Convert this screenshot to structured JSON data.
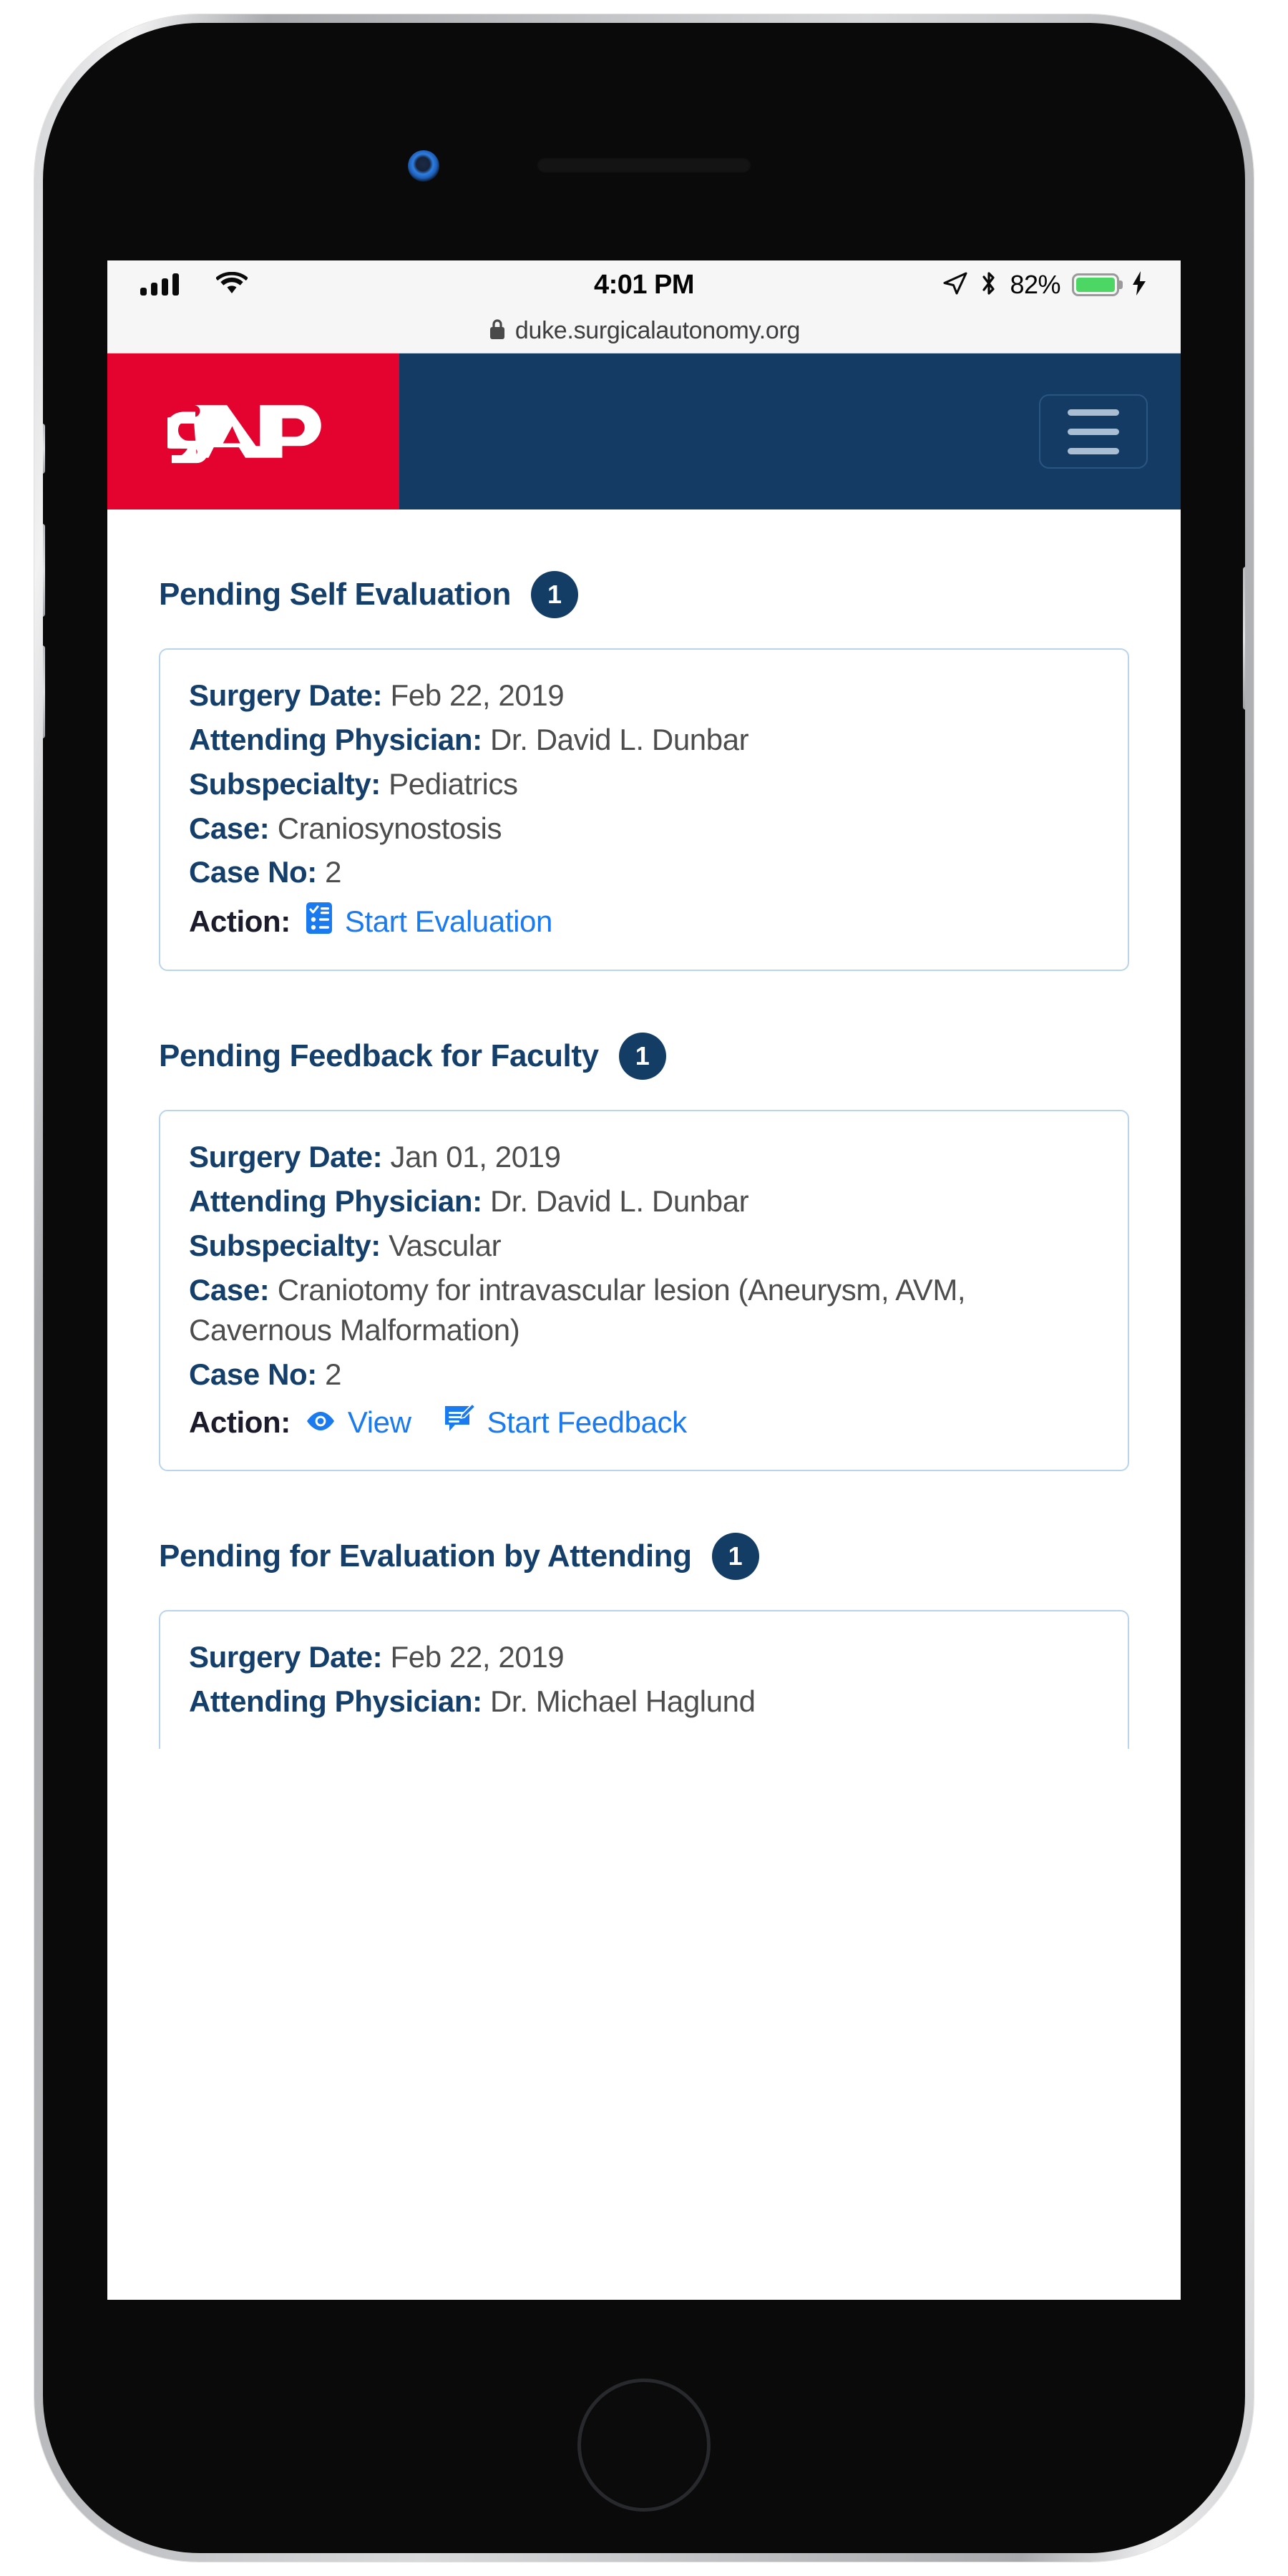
{
  "status_bar": {
    "time": "4:01 PM",
    "battery_percent": "82%",
    "signal_icon": "cellular-signal-icon",
    "wifi_icon": "wifi-icon",
    "location_icon": "location-arrow-icon",
    "bluetooth_icon": "bluetooth-icon",
    "battery_icon": "battery-icon",
    "charging_icon": "lightning-bolt-icon",
    "battery_color": "#4cd764"
  },
  "browser": {
    "lock_icon": "lock-icon",
    "url": "duke.surgicalautonomy.org"
  },
  "header": {
    "brand": "SAP",
    "brand_bg": "#e4032e",
    "header_bg": "#133b63",
    "menu_icon": "hamburger-menu-icon"
  },
  "sections": [
    {
      "title": "Pending Self Evaluation",
      "count": "1",
      "card": {
        "fields": [
          {
            "label": "Surgery Date:",
            "value": "Feb 22, 2019"
          },
          {
            "label": "Attending Physician:",
            "value": "Dr. David L. Dunbar"
          },
          {
            "label": "Subspecialty:",
            "value": "Pediatrics"
          },
          {
            "label": "Case:",
            "value": "Craniosynostosis"
          },
          {
            "label": "Case No:",
            "value": "2"
          }
        ],
        "action_label": "Action:",
        "actions": [
          {
            "label": "Start Evaluation",
            "icon": "clipboard-list-icon"
          }
        ]
      }
    },
    {
      "title": "Pending Feedback for Faculty",
      "count": "1",
      "card": {
        "fields": [
          {
            "label": "Surgery Date:",
            "value": "Jan 01, 2019"
          },
          {
            "label": "Attending Physician:",
            "value": "Dr. David L. Dunbar"
          },
          {
            "label": "Subspecialty:",
            "value": "Vascular"
          },
          {
            "label": "Case:",
            "value": "Craniotomy for intravascular lesion (Aneurysm, AVM, Cavernous Malformation)"
          },
          {
            "label": "Case No:",
            "value": "2"
          }
        ],
        "action_label": "Action:",
        "actions": [
          {
            "label": "View",
            "icon": "eye-icon"
          },
          {
            "label": "Start Feedback",
            "icon": "comment-edit-icon"
          }
        ]
      }
    },
    {
      "title": "Pending for Evaluation by Attending",
      "count": "1",
      "card": {
        "fields": [
          {
            "label": "Surgery Date:",
            "value": "Feb 22, 2019"
          },
          {
            "label": "Attending Physician:",
            "value": "Dr. Michael Haglund"
          }
        ]
      }
    }
  ],
  "colors": {
    "navy": "#153f6b",
    "link_blue": "#1a7af0",
    "card_border": "#b9d4ec",
    "badge_bg": "#143d66",
    "brand_red": "#e4032e"
  }
}
